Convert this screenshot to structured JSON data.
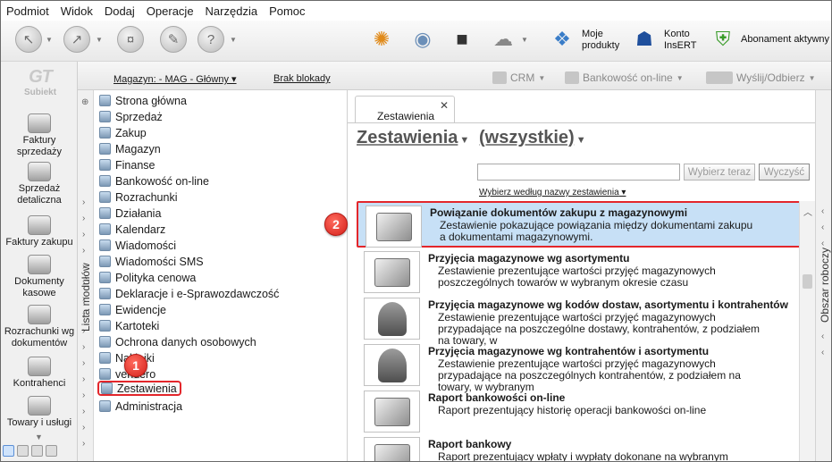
{
  "menu": [
    "Podmiot",
    "Widok",
    "Dodaj",
    "Operacje",
    "Narzędzia",
    "Pomoc"
  ],
  "toolbar": {
    "moje_produkty": [
      "Moje",
      "produkty"
    ],
    "konto_insert": [
      "Konto",
      "InsERT"
    ],
    "abonament": "Abonament aktywny"
  },
  "logo": "Subiekt",
  "left_nav": [
    "Faktury sprzedaży",
    "Sprzedaż detaliczna",
    "Faktury zakupu",
    "Dokumenty kasowe",
    "Rozrachunki wg dokumentów",
    "Kontrahenci",
    "Towary i usługi"
  ],
  "magbar": {
    "magazyn": "Magazyn: - MAG - Główny",
    "blokady": "Brak blokady",
    "crm": "CRM",
    "bank": "Bankowość on-line",
    "send": "Wyślij/Odbierz"
  },
  "modules_side_label": "Lista modułów",
  "modules": [
    "Strona główna",
    "Sprzedaż",
    "Zakup",
    "Magazyn",
    "Finanse",
    "Bankowość on-line",
    "Rozrachunki",
    "Działania",
    "Kalendarz",
    "Wiadomości",
    "Wiadomości SMS",
    "Polityka cenowa",
    "Deklaracje i e-Sprawozdawczość",
    "Ewidencje",
    "Kartoteki",
    "Ochrona danych osobowych",
    "Naklejki",
    "vendero",
    "Zestawienia",
    "Administracja"
  ],
  "main": {
    "tab": "Zestawienia",
    "heading": "Zestawienia",
    "filter": "(wszystkie)",
    "search_value": "",
    "choose_btn": "Wybierz teraz",
    "clear_btn": "Wyczyść",
    "sort_link": "Wybierz według nazwy zestawienia"
  },
  "reports": [
    {
      "title": "Powiązanie dokumentów zakupu z magazynowymi",
      "desc": "Zestawienie pokazujące powiązania między dokumentami zakupu a dokumentami magazynowymi."
    },
    {
      "title": "Przyjęcia magazynowe wg asortymentu",
      "desc": "Zestawienie prezentujące wartości przyjęć magazynowych poszczególnych towarów w wybranym okresie czasu"
    },
    {
      "title": "Przyjęcia magazynowe wg kodów dostaw, asortymentu i kontrahentów",
      "desc": "Zestawienie prezentujące wartości przyjęć magazynowych przypadające na poszczególne dostawy, kontrahentów, z podziałem na towary, w"
    },
    {
      "title": "Przyjęcia magazynowe wg kontrahentów i asortymentu",
      "desc": "Zestawienie prezentujące wartości przyjęć magazynowych przypadające na poszczególnych kontrahentów, z podziałem na towary, w wybranym"
    },
    {
      "title": "Raport bankowości on-line",
      "desc": "Raport prezentujący historię operacji bankowości on-line"
    },
    {
      "title": "Raport bankowy",
      "desc": "Raport prezentujący wpłaty i wypłaty dokonane na wybranym rachunku"
    }
  ],
  "right_panel_label": "Obszar roboczy",
  "badges": [
    "1",
    "2"
  ],
  "colors": {
    "selection": "#c7e0f6",
    "highlight": "#e3262b"
  }
}
